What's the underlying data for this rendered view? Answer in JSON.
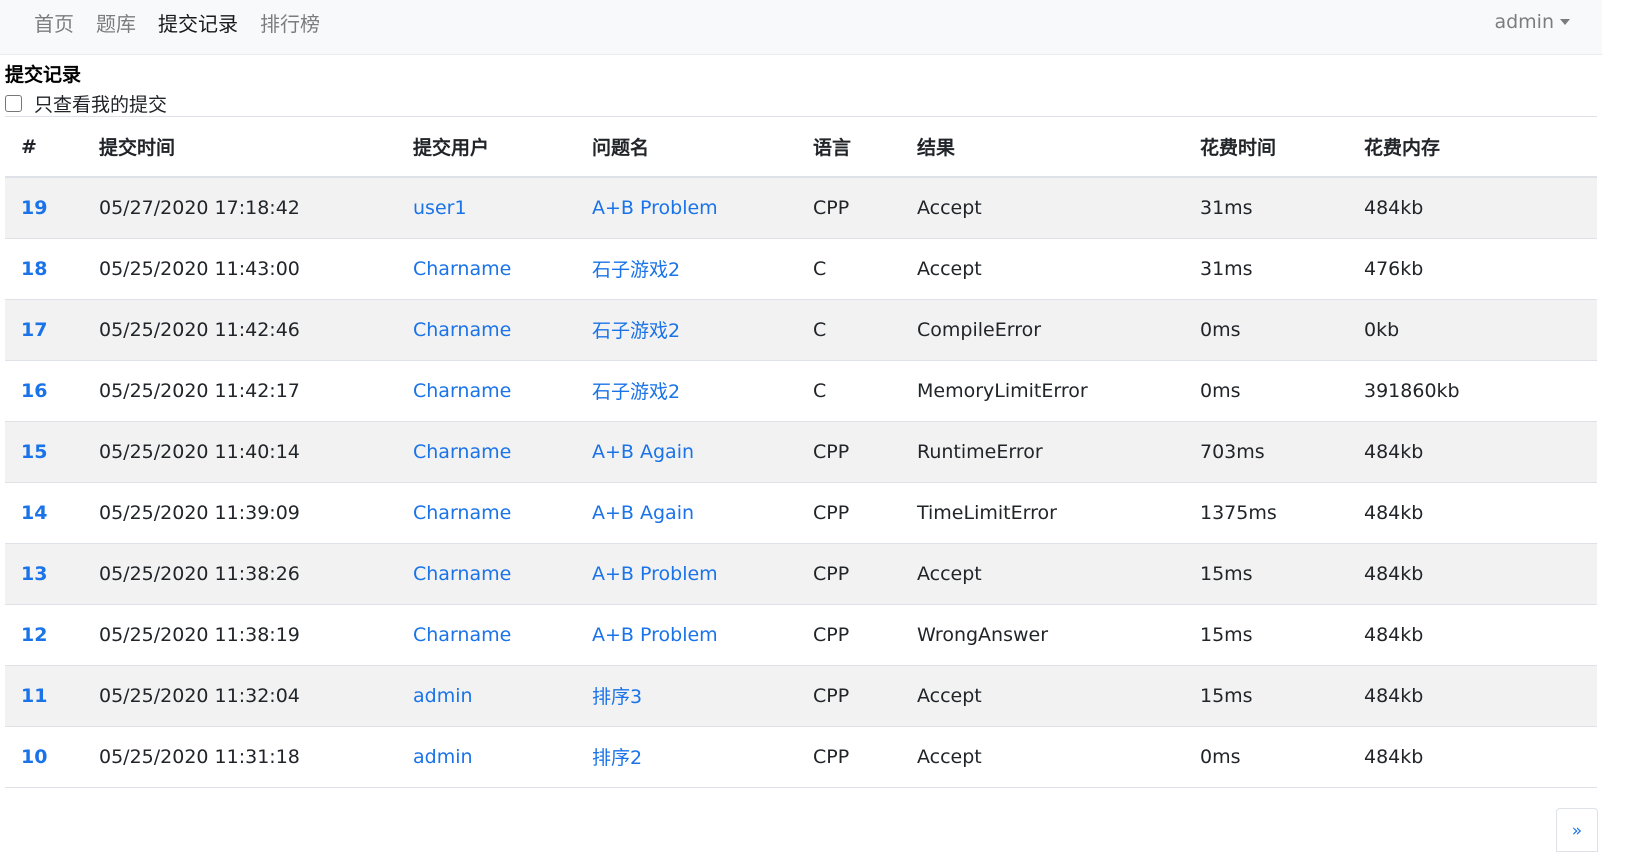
{
  "nav": {
    "items": [
      {
        "label": "首页",
        "active": false
      },
      {
        "label": "题库",
        "active": false
      },
      {
        "label": "提交记录",
        "active": true
      },
      {
        "label": "排行榜",
        "active": false
      }
    ],
    "user": "admin"
  },
  "page": {
    "title": "提交记录",
    "filter_label": "只查看我的提交",
    "filter_checked": false
  },
  "table": {
    "headers": [
      "#",
      "提交时间",
      "提交用户",
      "问题名",
      "语言",
      "结果",
      "花费时间",
      "花费内存"
    ],
    "rows": [
      {
        "id": "19",
        "time": "05/27/2020 17:18:42",
        "user": "user1",
        "problem": "A+B Problem",
        "lang": "CPP",
        "result": "Accept",
        "cost_time": "31ms",
        "cost_mem": "484kb"
      },
      {
        "id": "18",
        "time": "05/25/2020 11:43:00",
        "user": "Charname",
        "problem": "石子游戏2",
        "lang": "C",
        "result": "Accept",
        "cost_time": "31ms",
        "cost_mem": "476kb"
      },
      {
        "id": "17",
        "time": "05/25/2020 11:42:46",
        "user": "Charname",
        "problem": "石子游戏2",
        "lang": "C",
        "result": "CompileError",
        "cost_time": "0ms",
        "cost_mem": "0kb"
      },
      {
        "id": "16",
        "time": "05/25/2020 11:42:17",
        "user": "Charname",
        "problem": "石子游戏2",
        "lang": "C",
        "result": "MemoryLimitError",
        "cost_time": "0ms",
        "cost_mem": "391860kb"
      },
      {
        "id": "15",
        "time": "05/25/2020 11:40:14",
        "user": "Charname",
        "problem": "A+B Again",
        "lang": "CPP",
        "result": "RuntimeError",
        "cost_time": "703ms",
        "cost_mem": "484kb"
      },
      {
        "id": "14",
        "time": "05/25/2020 11:39:09",
        "user": "Charname",
        "problem": "A+B Again",
        "lang": "CPP",
        "result": "TimeLimitError",
        "cost_time": "1375ms",
        "cost_mem": "484kb"
      },
      {
        "id": "13",
        "time": "05/25/2020 11:38:26",
        "user": "Charname",
        "problem": "A+B Problem",
        "lang": "CPP",
        "result": "Accept",
        "cost_time": "15ms",
        "cost_mem": "484kb"
      },
      {
        "id": "12",
        "time": "05/25/2020 11:38:19",
        "user": "Charname",
        "problem": "A+B Problem",
        "lang": "CPP",
        "result": "WrongAnswer",
        "cost_time": "15ms",
        "cost_mem": "484kb"
      },
      {
        "id": "11",
        "time": "05/25/2020 11:32:04",
        "user": "admin",
        "problem": "排序3",
        "lang": "CPP",
        "result": "Accept",
        "cost_time": "15ms",
        "cost_mem": "484kb"
      },
      {
        "id": "10",
        "time": "05/25/2020 11:31:18",
        "user": "admin",
        "problem": "排序2",
        "lang": "CPP",
        "result": "Accept",
        "cost_time": "0ms",
        "cost_mem": "484kb"
      }
    ]
  },
  "pagination": {
    "next_label": "»"
  },
  "colors": {
    "link": "#1a73e8",
    "navbar_bg": "#f8f9fa",
    "stripe": "#f2f2f2"
  }
}
